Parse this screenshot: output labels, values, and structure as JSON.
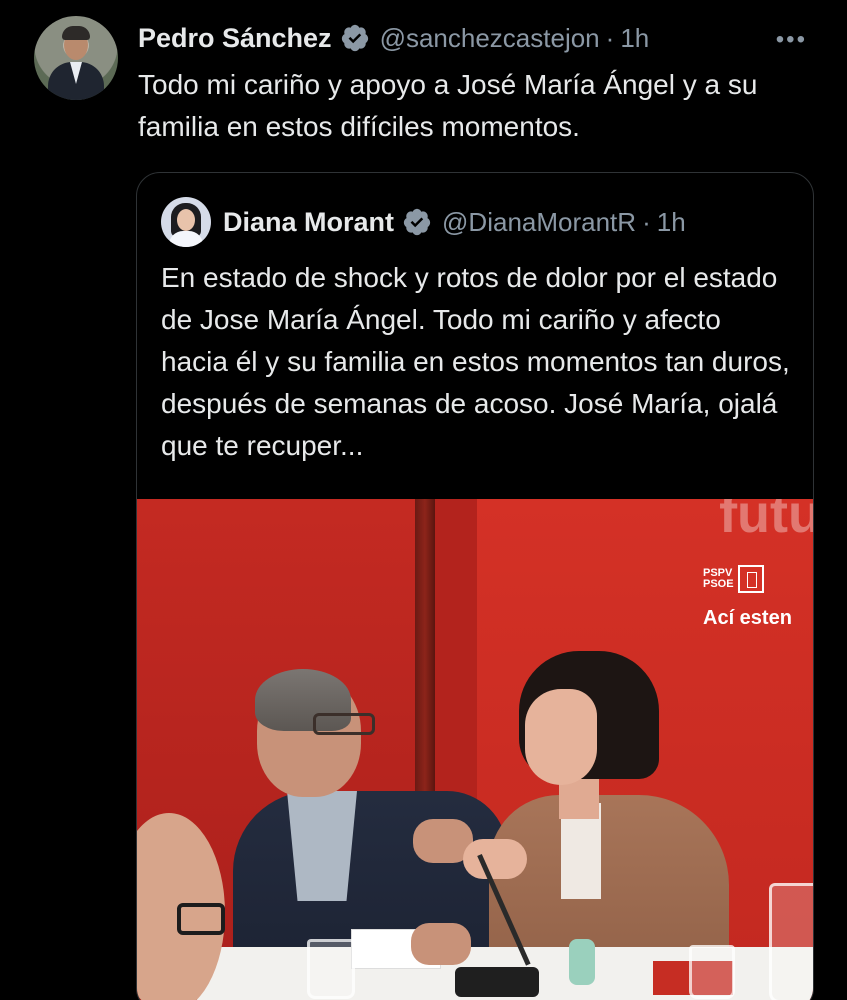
{
  "tweet": {
    "author_name": "Pedro Sánchez",
    "author_handle": "@sanchezcastejon",
    "separator": "·",
    "time": "1h",
    "more_icon": "more-horizontal-icon",
    "text": "Todo mi cariño y apoyo a José María Ángel y a su familia en estos difíciles momentos."
  },
  "quoted_tweet": {
    "author_name": "Diana Morant",
    "author_handle": "@DianaMorantR",
    "separator": "·",
    "time": "1h",
    "text": "En estado de shock y rotos de dolor por el estado de Jose María Ángel. Todo mi cariño y afecto hacia él y su familia en estos momentos tan duros, después de semanas de acoso. José María, ojalá que te recuper..."
  },
  "photo": {
    "wall_text": "futu",
    "logo_line1": "PSPV",
    "logo_line2": "PSOE",
    "slogan": "Ací esten"
  },
  "colors": {
    "background": "#000000",
    "primary_text": "#e7e9ea",
    "secondary_text": "#8b98a5",
    "verified_badge": "#8b98a5",
    "border": "#2f3336",
    "wall_red": "#c42a22"
  }
}
